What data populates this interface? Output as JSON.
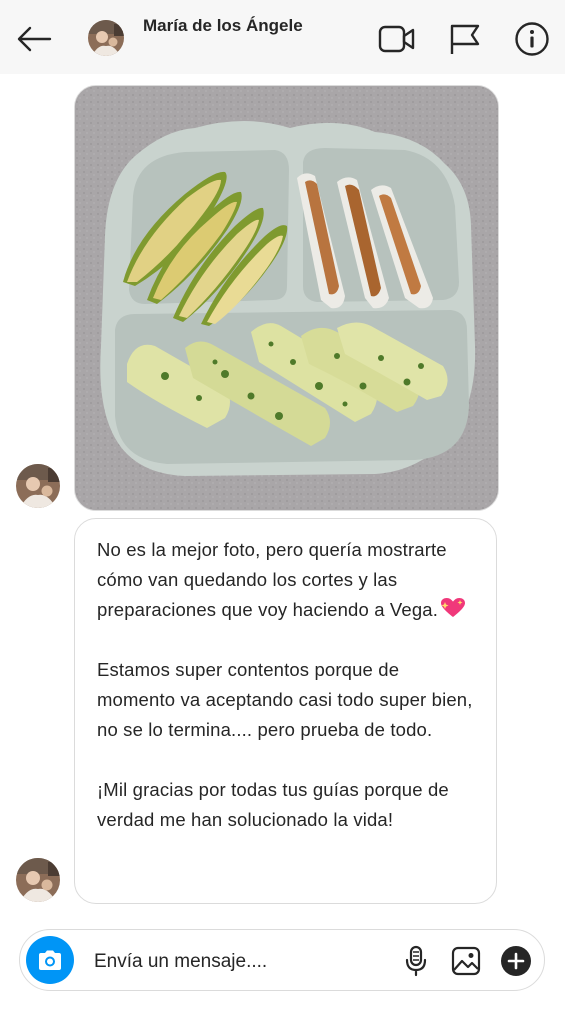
{
  "header": {
    "contact_name": "María de los Ángeles",
    "icons": [
      "back-arrow-icon",
      "video-call-icon",
      "flag-icon",
      "info-icon"
    ]
  },
  "messages": [
    {
      "type": "photo",
      "description_icon": "food-plate-image"
    },
    {
      "type": "text",
      "paragraphs": [
        "No es la mejor foto, pero quería mostrarte cómo van quedando los cortes y las preparaciones que voy haciendo a Vega.",
        "Estamos super contentos porque de momento va aceptando casi todo super bien, no se lo termina.... pero prueba de todo.",
        "¡Mil gracias por todas tus guías porque de verdad me han solucionado la vida!"
      ],
      "emoji": "sparkling-heart-icon"
    }
  ],
  "composer": {
    "placeholder": "Envía un mensaje....",
    "value": "",
    "icons": [
      "camera-icon",
      "microphone-icon",
      "image-icon",
      "plus-icon"
    ]
  },
  "colors": {
    "accent": "#0095f6",
    "header_bg": "#f7f7f7",
    "border": "#dbdbdb",
    "text": "#262626"
  }
}
